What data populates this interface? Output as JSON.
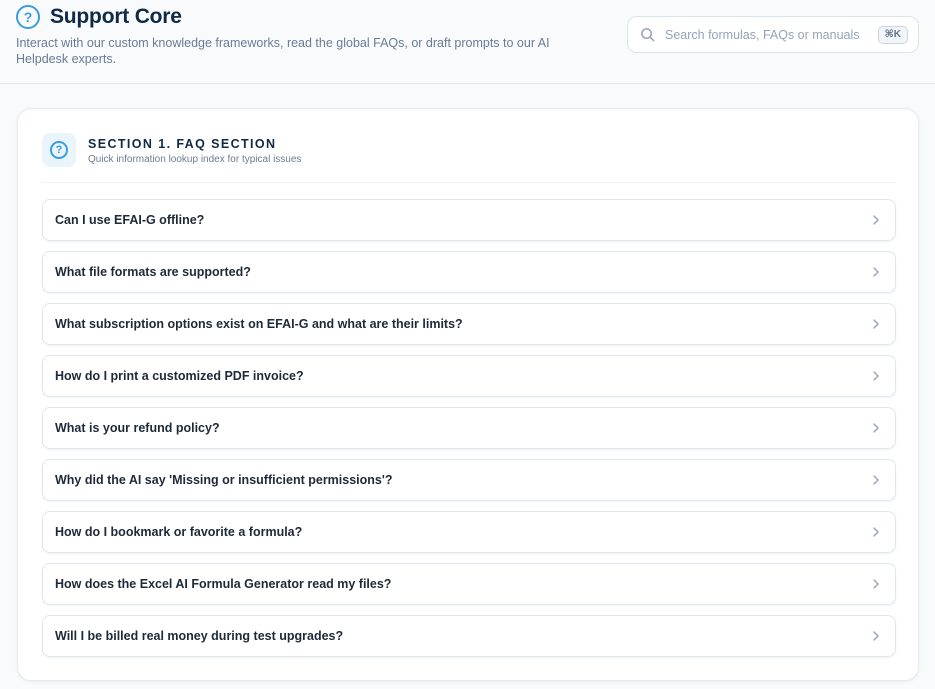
{
  "header": {
    "title": "Support Core",
    "subtitle": "Interact with our custom knowledge frameworks, read the global FAQs, or draft prompts to our AI Helpdesk experts.",
    "title_icon": "question-circle-icon",
    "icon_glyph": "?"
  },
  "search": {
    "placeholder": "Search formulas, FAQs or manuals",
    "value": "",
    "shortcut": "⌘K",
    "icon": "search-icon"
  },
  "section": {
    "title": "SECTION 1. FAQ SECTION",
    "subtitle": "Quick information lookup index for typical issues",
    "icon": "question-circle-icon"
  },
  "faqs": [
    {
      "question": "Can I use EFAI-G offline?"
    },
    {
      "question": "What file formats are supported?"
    },
    {
      "question": "What subscription options exist on EFAI-G and what are their limits?"
    },
    {
      "question": "How do I print a customized PDF invoice?"
    },
    {
      "question": "What is your refund policy?"
    },
    {
      "question": "Why did the AI say 'Missing or insufficient permissions'?"
    },
    {
      "question": "How do I bookmark or favorite a formula?"
    },
    {
      "question": "How does the Excel AI Formula Generator read my files?"
    },
    {
      "question": "Will I be billed real money during test upgrades?"
    }
  ],
  "colors": {
    "accent": "#3b9ddd",
    "title_text": "#0f2a44",
    "muted_text": "#6b7c93",
    "border": "#dfe6ee"
  }
}
